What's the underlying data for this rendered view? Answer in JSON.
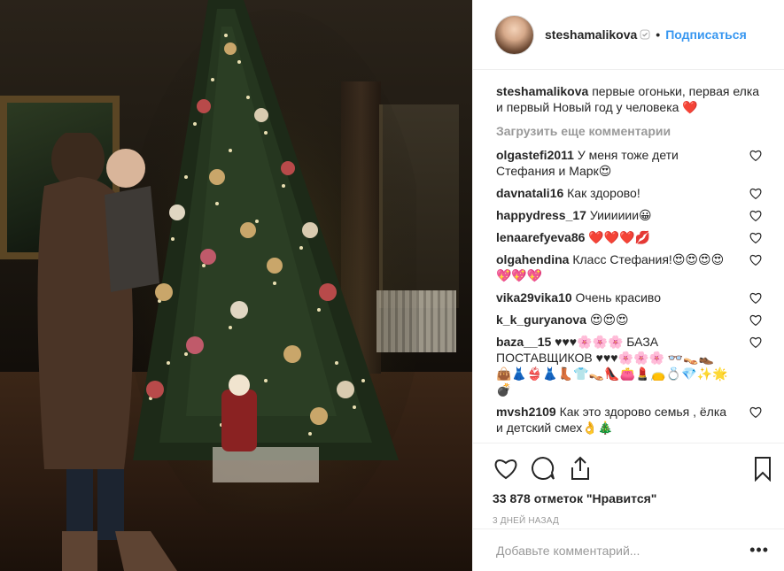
{
  "post": {
    "username": "steshamalikova",
    "follow_label": "Подписаться",
    "dot": "•",
    "caption": {
      "username": "steshamalikova",
      "text": "первые огоньки, первая елка и первый Новый год у человека ❤️"
    },
    "load_more_label": "Загрузить еще комментарии",
    "comments": [
      {
        "user": "olgastefi2011",
        "text": "У меня тоже дети Стефания и Марк😍"
      },
      {
        "user": "davnatali16",
        "text": "Как здорово!"
      },
      {
        "user": "happydress_17",
        "text": "Уииииии😀"
      },
      {
        "user": "lenaarefyeva86",
        "text": "❤️❤️❤️💋"
      },
      {
        "user": "olgahendina",
        "text": "Класс Стефания!😍😍😍😍 💖💖💖"
      },
      {
        "user": "vika29vika10",
        "text": "Очень красиво"
      },
      {
        "user": "k_k_guryanova",
        "text": "😍😍😍"
      },
      {
        "user": "baza__15",
        "text": "♥♥♥🌸🌸🌸 БАЗА ПОСТАВЩИКОВ ♥♥♥🌸🌸🌸 👓👡👞 👜👗👙👗👢👕👡👠👛💄👝💍💎✨🌟💣"
      },
      {
        "user": "mvsh2109",
        "text": "Как это здорово семья , ёлка и детский смех👌🎄"
      }
    ],
    "likes_label": "33 878 отметок \"Нравится\"",
    "time_label": "3 дней назад",
    "add_comment_placeholder": "Добавьте комментарий...",
    "more_label": "•••"
  }
}
